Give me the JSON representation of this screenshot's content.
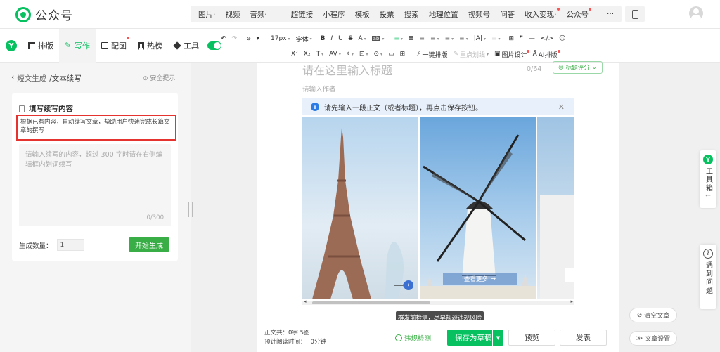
{
  "brand": {
    "title": "公众号"
  },
  "topnav": {
    "groups": [
      [
        "图片·",
        "视频",
        "音频·"
      ],
      [
        "超链接",
        "小程序",
        "模板",
        "投票",
        "搜索",
        "地理位置",
        "视频号",
        "问答",
        "收入变现·",
        "公众号"
      ],
      [
        "···"
      ]
    ]
  },
  "tabs": [
    {
      "label": "排版",
      "icon": "layout-icon"
    },
    {
      "label": "写作",
      "icon": "ai-write-icon",
      "active": true
    },
    {
      "label": "配图",
      "icon": "image-icon"
    },
    {
      "label": "热榜",
      "icon": "bookmark-icon"
    },
    {
      "label": "工具",
      "icon": "cube-icon"
    }
  ],
  "fmt_row1": [
    "↶",
    "↷",
    "⌀",
    "▾",
    "17px",
    "字体",
    "B",
    "I",
    "U",
    "S",
    "A",
    "ab",
    "≡",
    "≣",
    "≡",
    "≡",
    "≡",
    "≡",
    "|A|",
    "≡",
    "⊞",
    "❞",
    "—",
    "</>",
    "☺"
  ],
  "fmt_row2": {
    "items": [
      "X²",
      "X₂",
      "T",
      "AV",
      "⌖",
      "⊡",
      "⊙",
      "▭",
      "⊞"
    ],
    "one_key": "一键排版",
    "mark_line": "重点划线",
    "pic_design": "图片设计",
    "ai_layout": "AI排版"
  },
  "sidebar": {
    "back_prefix": "短文生成",
    "back_current": "/文本续写",
    "safe_tip": "安全提示",
    "card_title": "填写续写内容",
    "description": "根据已有内容，自动续写文章，帮助用户快速完成长篇文章的撰写",
    "placeholder": "请输入续写的内容，超过 300 字时请在右侧编辑框内划词续写",
    "char_count": "0/300",
    "gen_count_label": "生成数量：",
    "gen_count_value": "1",
    "start_button": "开始生成"
  },
  "editor": {
    "title_placeholder": "请在这里输入标题",
    "title_count": "0/64",
    "title_score": "标题评分",
    "author_placeholder": "请输入作者",
    "info_text": "请先输入一段正文（或者标题），再点击保存按钮。",
    "view_more": "查看更多"
  },
  "footer": {
    "word_count": "正文共：0字 5图",
    "read_time_label": "预计阅读时间：",
    "read_time": "0分钟",
    "violation_check": "违规检测",
    "tooltip": "群发前检测，尽早规避违规风险",
    "save_draft": "保存为草稿",
    "preview": "预览",
    "publish": "发表"
  },
  "right": {
    "toolbox": "工具箱",
    "help": "遇到问题",
    "clear": "清空文章",
    "settings": "文章设置"
  }
}
